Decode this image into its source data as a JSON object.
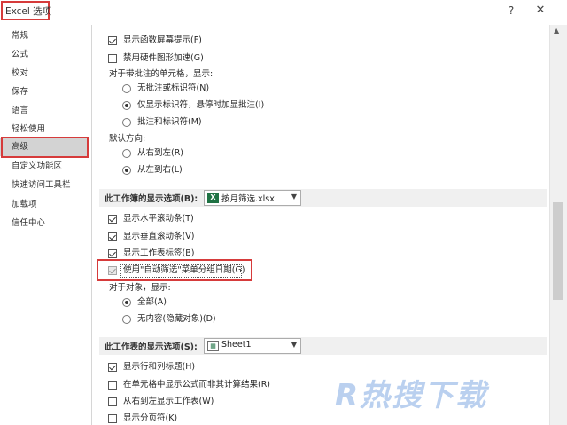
{
  "window": {
    "title": "Excel 选项",
    "help_label": "?",
    "close_label": "✕"
  },
  "sidebar": {
    "items": [
      {
        "label": "常规"
      },
      {
        "label": "公式"
      },
      {
        "label": "校对"
      },
      {
        "label": "保存"
      },
      {
        "label": "语言"
      },
      {
        "label": "轻松使用"
      },
      {
        "label": "高级",
        "selected": true
      },
      {
        "label": "自定义功能区"
      },
      {
        "label": "快速访问工具栏"
      },
      {
        "label": "加载项"
      },
      {
        "label": "信任中心"
      }
    ]
  },
  "options": {
    "show_screentips": "显示函数屏幕提示(F)",
    "disable_hw_accel": "禁用硬件图形加速(G)",
    "comments_heading": "对于带批注的单元格，显示:",
    "no_comments": "无批注或标识符(N)",
    "indicators_only": "仅显示标识符，悬停时加显批注(I)",
    "comments_and_indicators": "批注和标识符(M)",
    "direction_heading": "默认方向:",
    "right_to_left": "从右到左(R)",
    "left_to_right": "从左到右(L)"
  },
  "workbook_section": {
    "label": "此工作簿的显示选项(B):",
    "selected": "按月筛选.xlsx",
    "show_hscroll": "显示水平滚动条(T)",
    "show_vscroll": "显示垂直滚动条(V)",
    "show_sheet_tabs": "显示工作表标签(B)",
    "group_dates": "使用\"自动筛选\"菜单分组日期(G)",
    "objects_heading": "对于对象，显示:",
    "objects_all": "全部(A)",
    "objects_none": "无内容(隐藏对象)(D)"
  },
  "worksheet_section": {
    "label": "此工作表的显示选项(S):",
    "selected": "Sheet1",
    "show_headers": "显示行和列标题(H)",
    "show_formulas": "在单元格中显示公式而非其计算结果(R)",
    "sheet_rtl": "从右到左显示工作表(W)",
    "show_page_breaks": "显示分页符(K)"
  },
  "icons": {
    "excel_file": "excel-file-icon",
    "sheet": "sheet-icon",
    "dropdown": "chevron-down-icon"
  },
  "colors": {
    "highlight_red": "#d63b3b",
    "selected_nav": "#d3d3d3",
    "excel_green": "#1f7244"
  },
  "watermark": "R热搜下载"
}
